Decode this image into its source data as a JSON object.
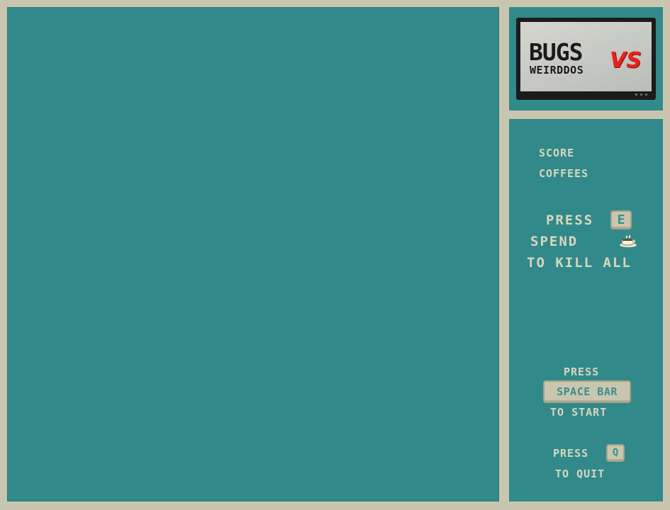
{
  "logo": {
    "title_main": "BUGS",
    "title_vs": "VS",
    "title_sub": "WEIRDDOS"
  },
  "stats": {
    "score_label": "SCORE",
    "coffees_label": "COFFEES"
  },
  "special": {
    "press_label": "PRESS",
    "key": "E",
    "spend_label": "SPEND",
    "cost_icon": "coffee-cup-icon",
    "action_label": "TO KILL ALL"
  },
  "start": {
    "press_label": "PRESS",
    "key": "SPACE BAR",
    "action_label": "TO START"
  },
  "quit": {
    "press_label": "PRESS",
    "key": "Q",
    "action_label": "TO QUIT"
  },
  "colors": {
    "board": "#318a89",
    "frame": "#c9c6b0",
    "text": "#d9d6bf",
    "logo_vs": "#e8221d"
  }
}
